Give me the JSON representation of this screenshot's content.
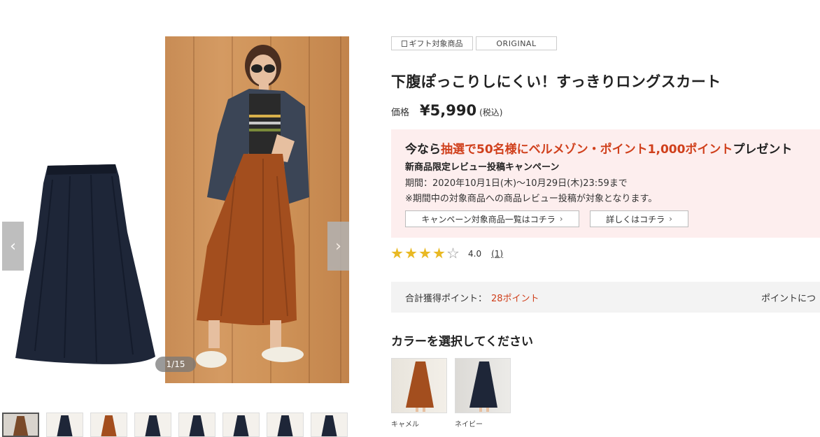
{
  "gallery": {
    "counter": "1/15",
    "prev_label": "‹",
    "next_label": "›",
    "thumb_colors": [
      "#7a4a2a",
      "#1e2638",
      "#a34e1e",
      "#1e2638",
      "#1e2638",
      "#1e2638",
      "#1e2638",
      "#1e2638"
    ]
  },
  "tags": {
    "gift": "ギフト対象商品",
    "original": "ORIGINAL"
  },
  "product": {
    "title": "下腹ぽっこりしにくい！すっきりロングスカート",
    "price_label": "価格",
    "price": "¥5,990",
    "tax": "(税込)"
  },
  "campaign": {
    "head_pre": "今なら",
    "head_red": "抽選で50名様にベルメゾン・ポイント1,000ポイント",
    "head_post": "プレゼント",
    "sub": "新商品限定レビュー投稿キャンペーン",
    "period": "期間：2020年10月1日(木)〜10月29日(木)23:59まで",
    "note": "※期間中の対象商品への商品レビュー投稿が対象となります。",
    "button_list": "キャンペーン対象商品一覧はコチラ",
    "button_detail": "詳しくはコチラ"
  },
  "rating": {
    "value": "4.0",
    "count": "(1)",
    "score": 4,
    "max": 5
  },
  "points": {
    "label": "合計獲得ポイント：",
    "value": "28ポイント",
    "more": "ポイントにつ"
  },
  "colors": {
    "title": "カラーを選択してください",
    "options": [
      {
        "name": "キャメル",
        "hex": "#a34e1e"
      },
      {
        "name": "ネイビー",
        "hex": "#1e2638"
      }
    ]
  },
  "accent": {
    "red": "#d0401c",
    "star": "#e9b923",
    "campaign_bg": "#fdeeee"
  }
}
